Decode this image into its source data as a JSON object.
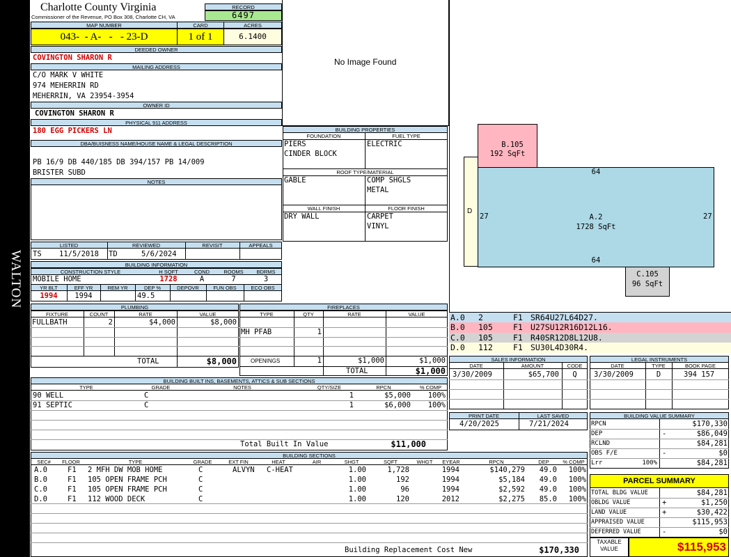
{
  "county": {
    "name": "Charlotte County Virginia",
    "commissioner": "Commissioner of the Revenue, PO Box 308, Charlotte CH, VA"
  },
  "side_label": "WALTON",
  "record": {
    "label": "RECORD",
    "value": "6497"
  },
  "map": {
    "label": "MAP NUMBER",
    "value": "043-  - A-   -   - 23-D"
  },
  "card": {
    "label": "CARD",
    "value": "1 of 1"
  },
  "acres": {
    "label": "ACRES",
    "value": "6.1400"
  },
  "deeded_owner": {
    "label": "DEEDED OWNER",
    "value": "COVINGTON SHARON R"
  },
  "mailing": {
    "label": "MAILING ADDRESS",
    "lines": [
      "C/O MARK V WHITE",
      "974 MEHERRIN RD",
      "MEHERRIN, VA 23954-3954"
    ]
  },
  "owner_id": {
    "label": "OWNER ID",
    "value": "COVINGTON SHARON R"
  },
  "physical": {
    "label": "PHYSICAL 911 ADDRESS",
    "value": "180 EGG PICKERS LN"
  },
  "legal": {
    "label": "DBA/BUISNESS NAME/HOUSE NAME & LEGAL DESCRIPTION",
    "lines": [
      "PB 16/9 DB 440/185 DB 394/157 PB 14/009",
      "BRISTER SUBD"
    ]
  },
  "notes": {
    "label": "NOTES"
  },
  "image_text": "No Image Found",
  "dates": {
    "listed_label": "LISTED",
    "reviewed_label": "REVIEWED",
    "revisit_label": "REVISIT",
    "appeals_label": "APPEALS",
    "listed_by": "TS",
    "listed": "11/5/2018",
    "reviewed_by": "TD",
    "reviewed": "5/6/2024"
  },
  "building_info": {
    "label": "BUILDING INFORMATION",
    "h": {
      "style": "CONSTRUCTION STYLE",
      "hsqft": "H SQFT",
      "cond": "COND",
      "rooms": "ROOMS",
      "bdrms": "BDRMS",
      "yrblt": "YR BLT",
      "effyr": "EFF YR",
      "remyr": "REM YR",
      "dep": "DEP %",
      "depovr": "DEPOVR",
      "funobs": "FUN OBS",
      "ecoobs": "ECO OBS"
    },
    "style": "MOBILE HOME",
    "hsqft": "1728",
    "cond": "A",
    "rooms": "7",
    "bdrms": "3",
    "yrblt": "1994",
    "effyr": "1994",
    "dep": "49.5"
  },
  "building_props": {
    "label": "BUILDING PROPERTIES",
    "foundation_label": "FOUNDATION",
    "fuel_label": "FUEL TYPE",
    "foundation": [
      "PIERS",
      "CINDER BLOCK"
    ],
    "fuel": [
      "ELECTRIC"
    ],
    "roof_label": "ROOF TYPE/MATERIAL",
    "roof_type": [
      "GABLE"
    ],
    "roof_material": [
      "COMP SHGLS",
      "METAL"
    ],
    "wall_label": "WALL FINISH",
    "floor_label": "FLOOR FINISH",
    "wall": [
      "DRY WALL"
    ],
    "floor": [
      "CARPET",
      "VINYL"
    ]
  },
  "plumbing": {
    "label": "PLUMBING",
    "h": [
      "FIXTURE",
      "COUNT",
      "RATE",
      "VALUE"
    ],
    "rows": [
      [
        "FULLBATH",
        "2",
        "$4,000",
        "$8,000"
      ]
    ],
    "total_label": "TOTAL",
    "total": "$8,000"
  },
  "fireplaces": {
    "label": "FIREPLACES",
    "h": [
      "TYPE",
      "QTY",
      "RATE",
      "VALUE"
    ],
    "rows": [
      [
        "MH PFAB",
        "1",
        "",
        ""
      ]
    ],
    "openings_label": "OPENINGS",
    "openings": [
      "1",
      "$1,000",
      "$1,000"
    ],
    "total_label": "TOTAL",
    "total": "$1,000"
  },
  "builtins": {
    "label": "BUILDING BUILT INS, BASEMENTS, ATTICS & SUB SECTIONS",
    "h": [
      "TYPE",
      "GRADE",
      "NOTES",
      "QTY/SIZE",
      "RPCN",
      "% COMP"
    ],
    "rows": [
      [
        "90 WELL",
        "C",
        "",
        "1",
        "$5,000",
        "100%"
      ],
      [
        "91 SEPTIC",
        "C",
        "",
        "1",
        "$6,000",
        "100%"
      ]
    ],
    "total_label": "Total Built In Value",
    "total": "$11,000"
  },
  "sections": {
    "label": "BUILDING SECTIONS",
    "h": [
      "SEC#",
      "FLOOR",
      "TYPE",
      "GRADE",
      "EXT FIN",
      "HEAT",
      "AIR",
      "SHGT",
      "SQFT",
      "WHGT",
      "EYEAR",
      "RPCN",
      "DEP",
      "% COMP"
    ],
    "rows": [
      [
        "A.0",
        "F1",
        "2 MFH DW MOB HOME",
        "C",
        "ALVYN",
        "C-HEAT",
        "",
        "1.00",
        "1,728",
        "",
        "1994",
        "$140,279",
        "49.0",
        "100%"
      ],
      [
        "B.0",
        "F1",
        "105 OPEN FRAME PCH",
        "C",
        "",
        "",
        "",
        "1.00",
        "192",
        "",
        "1994",
        "$5,184",
        "49.0",
        "100%"
      ],
      [
        "C.0",
        "F1",
        "105 OPEN FRAME PCH",
        "C",
        "",
        "",
        "",
        "1.00",
        "96",
        "",
        "1994",
        "$2,592",
        "49.0",
        "100%"
      ],
      [
        "D.0",
        "F1",
        "112 WOOD DECK",
        "C",
        "",
        "",
        "",
        "1.00",
        "120",
        "",
        "2012",
        "$2,275",
        "85.0",
        "100%"
      ]
    ],
    "brcn_label": "Building Replacement Cost New",
    "brcn": "$170,330"
  },
  "sketch": {
    "b_label": "B.105",
    "b_area": "192 SqFt",
    "a_label": "A.2",
    "a_area": "1728 SqFt",
    "c_label": "C.105",
    "c_area": "96 SqFt",
    "d_label": "D",
    "dim_top": "64",
    "dim_bottom": "64",
    "dim_left": "27",
    "dim_right": "27",
    "colors": {
      "a": "#add8e6",
      "b": "#ffb6c1",
      "c": "#d3d3d3",
      "d": "#fffde0"
    }
  },
  "segments": [
    {
      "sec": "A.0",
      "code": "2",
      "floor": "F1",
      "path": "SR64U27L64D27.",
      "color": "#c5dff0"
    },
    {
      "sec": "B.0",
      "code": "105",
      "floor": "F1",
      "path": "U27SU12R16D12L16.",
      "color": "#ffb6c1"
    },
    {
      "sec": "C.0",
      "code": "105",
      "floor": "F1",
      "path": "R40SR12D8L12U8.",
      "color": "#d3d3d3"
    },
    {
      "sec": "D.0",
      "code": "112",
      "floor": "F1",
      "path": "SU30L4D30R4.",
      "color": "#fffde0"
    }
  ],
  "sales": {
    "label": "SALES INFORMATION",
    "h": [
      "DATE",
      "AMOUNT",
      "CODE"
    ],
    "rows": [
      [
        "3/30/2009",
        "$65,700",
        "Q"
      ]
    ]
  },
  "legal_inst": {
    "label": "LEGAL INSTRUMENTS",
    "h": [
      "DATE",
      "TYPE",
      "BOOK PAGE"
    ],
    "rows": [
      [
        "3/30/2009",
        "D",
        "394 157"
      ]
    ]
  },
  "print": {
    "print_label": "PRINT DATE",
    "saved_label": "LAST SAVED",
    "print_date": "4/20/2025",
    "last_saved": "7/21/2024"
  },
  "bvs": {
    "label": "BUILDING VALUE SUMMARY",
    "rows": [
      [
        "RPCN",
        "",
        "",
        "$170,330"
      ],
      [
        "DEP",
        "",
        "-",
        "$86,049"
      ],
      [
        "RCLND",
        "",
        "",
        "$84,281"
      ],
      [
        "OBS F/E",
        "",
        "-",
        "$0"
      ],
      [
        "Lrr",
        "100%",
        "",
        "$84,281"
      ]
    ]
  },
  "parcel": {
    "label": "PARCEL SUMMARY",
    "rows": [
      [
        "TOTAL BLDG VALUE",
        "",
        "$84,281"
      ],
      [
        "OBLDG VALUE",
        "+",
        "$1,250"
      ],
      [
        "LAND VALUE",
        "+",
        "$30,422"
      ],
      [
        "APPRAISED VALUE",
        "",
        "$115,953"
      ],
      [
        "DEFERRED VALUE",
        "-",
        "$0"
      ]
    ],
    "taxable_label_1": "TAXABLE",
    "taxable_label_2": "VALUE",
    "taxable": "$115,953",
    "colors": {
      "yellow": "#ffff00",
      "red": "#d00000"
    }
  }
}
